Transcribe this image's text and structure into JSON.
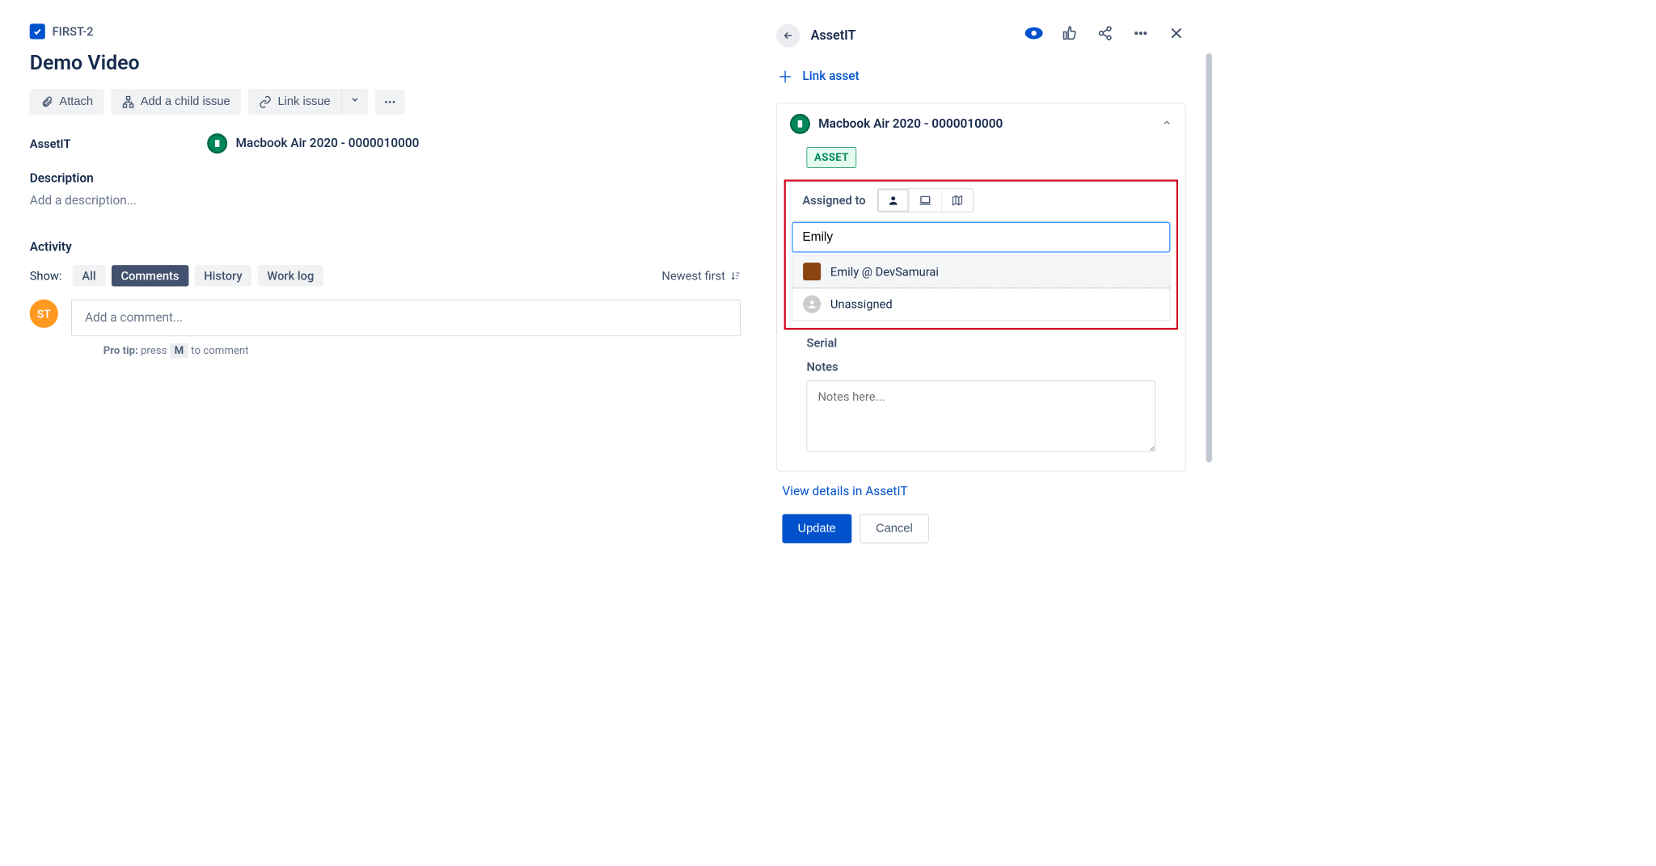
{
  "breadcrumb": {
    "issue_key": "FIRST-2"
  },
  "title": "Demo Video",
  "toolbar": {
    "attach": "Attach",
    "add_child": "Add a child issue",
    "link_issue": "Link issue"
  },
  "asset_field": {
    "label": "AssetIT",
    "value": "Macbook Air 2020 - 0000010000"
  },
  "description": {
    "heading": "Description",
    "placeholder": "Add a description..."
  },
  "activity": {
    "heading": "Activity",
    "show_label": "Show:",
    "tabs": {
      "all": "All",
      "comments": "Comments",
      "history": "History",
      "worklog": "Work log"
    },
    "sort": "Newest first",
    "comment_placeholder": "Add a comment...",
    "avatar_initials": "ST",
    "pro_tip_pre": "Pro tip:",
    "pro_tip_text": "press",
    "pro_tip_key": "M",
    "pro_tip_post": "to comment"
  },
  "sidebar": {
    "app_name": "AssetIT",
    "link_asset": "Link asset",
    "asset_title": "Macbook Air 2020 - 0000010000",
    "badge": "ASSET",
    "assigned_to": "Assigned to",
    "search_value": "Emily",
    "options": [
      {
        "label": "Emily @ DevSamurai"
      },
      {
        "label": "Unassigned"
      }
    ],
    "serial": "Serial",
    "notes": "Notes",
    "notes_placeholder": "Notes here...",
    "view_details": "View details in AssetIT",
    "update": "Update",
    "cancel": "Cancel"
  }
}
